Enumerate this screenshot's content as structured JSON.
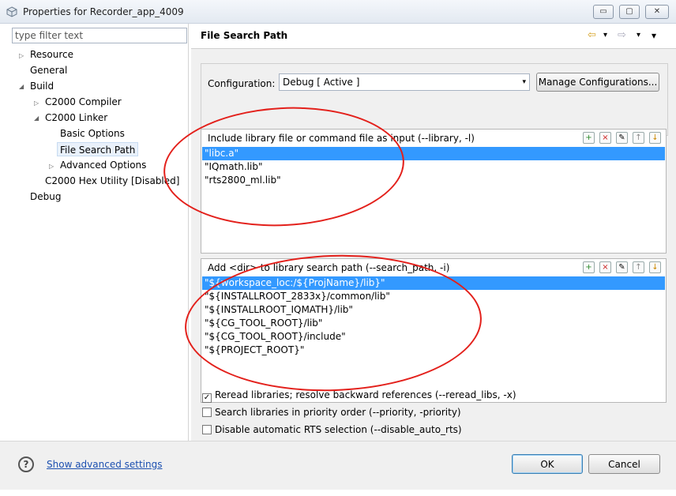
{
  "window": {
    "title": "Properties for Recorder_app_4009",
    "min_glyph": "▭",
    "max_glyph": "▢",
    "close_glyph": "✕"
  },
  "sidebar": {
    "filter_placeholder": "type filter text",
    "items": [
      {
        "label": "Resource"
      },
      {
        "label": "General"
      },
      {
        "label": "Build"
      },
      {
        "label": "C2000 Compiler"
      },
      {
        "label": "C2000 Linker"
      },
      {
        "label": "Basic Options"
      },
      {
        "label": "File Search Path"
      },
      {
        "label": "Advanced Options"
      },
      {
        "label": "C2000 Hex Utility  [Disabled]"
      },
      {
        "label": "Debug"
      }
    ],
    "glyphs": {
      "collapsed": "▷",
      "expanded": "◢"
    }
  },
  "header": {
    "page_title": "File Search Path",
    "back_glyph": "⇦",
    "forward_glyph": "⇨",
    "dropdown_glyph": "▾"
  },
  "configuration": {
    "label": "Configuration:",
    "value": "Debug  [ Active ]",
    "combo_arrow": "▾",
    "manage_label": "Manage Configurations..."
  },
  "tool_glyphs": {
    "add": "+",
    "delete": "×",
    "edit": "✎",
    "up": "↑",
    "down": "↓"
  },
  "library_group": {
    "title": "Include library file or command file as input (--library, -l)",
    "items": [
      "\"libc.a\"",
      "\"IQmath.lib\"",
      "\"rts2800_ml.lib\""
    ]
  },
  "search_group": {
    "title": "Add <dir> to library search path (--search_path, -i)",
    "items": [
      "\"${workspace_loc:/${ProjName}/lib}\"",
      "\"${INSTALLROOT_2833x}/common/lib\"",
      "\"${INSTALLROOT_IQMATH}/lib\"",
      "\"${CG_TOOL_ROOT}/lib\"",
      "\"${CG_TOOL_ROOT}/include\"",
      "\"${PROJECT_ROOT}\""
    ]
  },
  "options": [
    {
      "label": "Reread libraries; resolve backward references (--reread_libs, -x)",
      "checked": true
    },
    {
      "label": "Search libraries in priority order (--priority, -priority)",
      "checked": false
    },
    {
      "label": "Disable automatic RTS selection (--disable_auto_rts)",
      "checked": false
    }
  ],
  "footer": {
    "help_glyph": "?",
    "advanced_link": "Show advanced settings",
    "ok_label": "OK",
    "cancel_label": "Cancel"
  },
  "check_glyph": "✓",
  "colors": {
    "selection": "#3399ff",
    "annotation": "#e3201b",
    "link": "#1b4fb0"
  }
}
